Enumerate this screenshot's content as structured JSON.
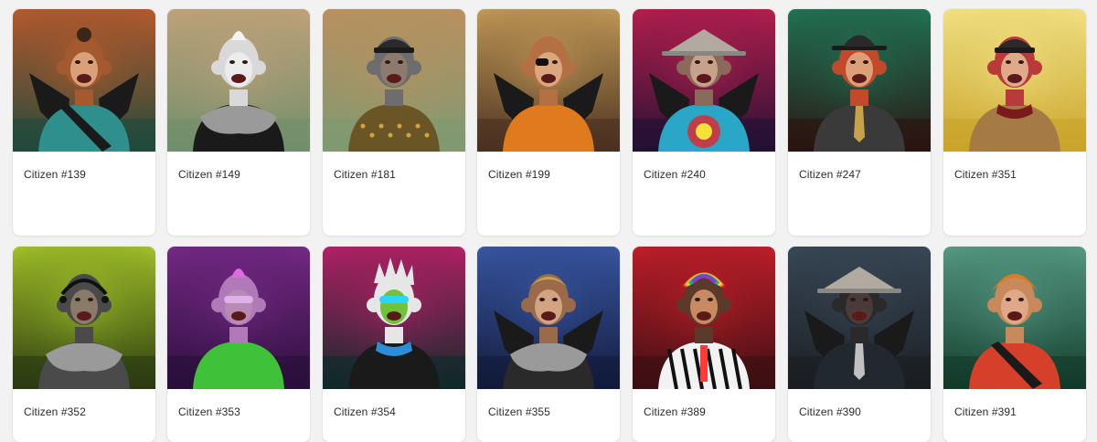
{
  "cards": [
    {
      "name": "Citizen #139",
      "bg": "#1f4a3c",
      "bg2": "#c25a2a",
      "fur": "#a45a2e",
      "face": "#d9a07a",
      "top": "#2f8f8c",
      "accent": "#f0f0f0",
      "wings": true,
      "hat": "hair-bun",
      "accessory": "sash"
    },
    {
      "name": "Citizen #149",
      "bg": "#6f8f6a",
      "bg2": "#c6a27a",
      "fur": "#d9d9d9",
      "face": "#ececec",
      "top": "#1a1a1a",
      "accent": "#8a8a8a",
      "wings": false,
      "hat": "mohawk",
      "accessory": "fur-collar"
    },
    {
      "name": "Citizen #181",
      "bg": "#7f9a72",
      "bg2": "#c08f5c",
      "fur": "#6d6d6d",
      "face": "#8d7a6e",
      "top": "#6a5526",
      "accent": "#d1a53a",
      "wings": false,
      "hat": "beanie",
      "accessory": "spikes"
    },
    {
      "name": "Citizen #199",
      "bg": "#4a3020",
      "bg2": "#c8a05a",
      "fur": "#b46f43",
      "face": "#dba77e",
      "top": "#e07a1e",
      "accent": "#111111",
      "wings": true,
      "hat": "none",
      "accessory": "eyepatch"
    },
    {
      "name": "Citizen #240",
      "bg": "#221133",
      "bg2": "#c01f4f",
      "fur": "#8a6a5a",
      "face": "#c7a18c",
      "top": "#2aa6c7",
      "accent": "#e8232a",
      "wings": true,
      "hat": "conical",
      "accessory": "tie-dye"
    },
    {
      "name": "Citizen #247",
      "bg": "#2a1410",
      "bg2": "#1f7a5a",
      "fur": "#c24a2a",
      "face": "#dd9f7a",
      "top": "#3a3a3a",
      "accent": "#c8a24a",
      "wings": false,
      "hat": "fedora",
      "accessory": "tie"
    },
    {
      "name": "Citizen #351",
      "bg": "#c9a42a",
      "bg2": "#f3e48a",
      "fur": "#b83a3a",
      "face": "#e0aa8a",
      "top": "#a57a44",
      "accent": "#7a1a1a",
      "wings": false,
      "hat": "beanie",
      "accessory": "scarf"
    },
    {
      "name": "Citizen #352",
      "bg": "#2a3a10",
      "bg2": "#a8c92a",
      "fur": "#4a4a4a",
      "face": "#8a7a6a",
      "top": "#4a4a4a",
      "accent": "#2ec84a",
      "wings": false,
      "hat": "headset",
      "accessory": "fur-collar"
    },
    {
      "name": "Citizen #353",
      "bg": "#2a0f3a",
      "bg2": "#7a2a8a",
      "fur": "#b07ab8",
      "face": "#b88ab4",
      "top": "#3fc23a",
      "accent": "#e06ae0",
      "wings": false,
      "hat": "mohawk",
      "accessory": "visor"
    },
    {
      "name": "Citizen #354",
      "bg": "#0f2a2a",
      "bg2": "#c01f6a",
      "fur": "#e6e6e6",
      "face": "#6fc23a",
      "top": "#1a1a1a",
      "accent": "#2a8fd6",
      "wings": false,
      "hat": "spiky",
      "accessory": "scarf"
    },
    {
      "name": "Citizen #355",
      "bg": "#121a3a",
      "bg2": "#3a5aa8",
      "fur": "#9a6a4a",
      "face": "#d1a582",
      "top": "#2a2a2a",
      "accent": "#e6e6e6",
      "wings": true,
      "hat": "blonde",
      "accessory": "fur-collar"
    },
    {
      "name": "Citizen #389",
      "bg": "#3a0f12",
      "bg2": "#c81f2a",
      "fur": "#5a3a2a",
      "face": "#c98a62",
      "top": "#f2f2f2",
      "accent": "#ff3a3a",
      "wings": false,
      "hat": "rainbow",
      "accessory": "zebra"
    },
    {
      "name": "Citizen #390",
      "bg": "#1a1e22",
      "bg2": "#3a4a5a",
      "fur": "#2a2a2a",
      "face": "#4a3a3a",
      "top": "#222830",
      "accent": "#c0c0c0",
      "wings": true,
      "hat": "conical",
      "accessory": "suit"
    },
    {
      "name": "Citizen #391",
      "bg": "#123a2a",
      "bg2": "#5aa08a",
      "fur": "#c88a5a",
      "face": "#e0a88a",
      "top": "#d6402a",
      "accent": "#1a1a1a",
      "wings": false,
      "hat": "orange-hair",
      "accessory": "sash"
    }
  ]
}
